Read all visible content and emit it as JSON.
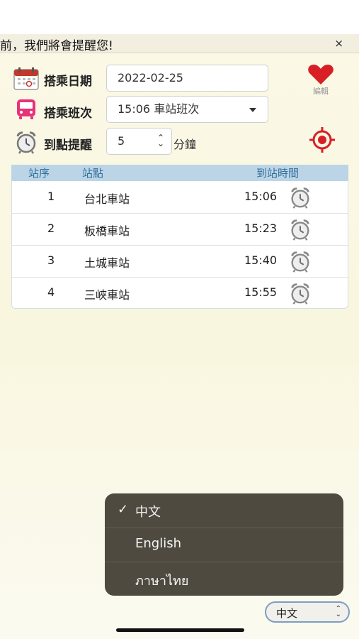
{
  "banner": {
    "text": "前，我們將會提醒您!",
    "close": "×"
  },
  "form": {
    "date_label": "搭乘日期",
    "date_value": "2022-02-25",
    "trip_label": "搭乘班次",
    "trip_value": "15:06 車站班次",
    "reminder_label": "到點提醒",
    "reminder_value": "5",
    "reminder_unit": "分鐘"
  },
  "actions": {
    "edit_label": "編輯"
  },
  "table": {
    "headers": [
      "站序",
      "站點",
      "到站時間"
    ],
    "rows": [
      {
        "seq": "1",
        "station": "台北車站",
        "time": "15:06"
      },
      {
        "seq": "2",
        "station": "板橋車站",
        "time": "15:23"
      },
      {
        "seq": "3",
        "station": "土城車站",
        "time": "15:40"
      },
      {
        "seq": "4",
        "station": "三峽車站",
        "time": "15:55"
      }
    ]
  },
  "language_menu": {
    "check": "✓",
    "options": [
      "中文",
      "English",
      "ภาษาไทย"
    ],
    "selected": "中文"
  },
  "language_select": {
    "value": "中文"
  },
  "colors": {
    "accent_red": "#d81f26",
    "header_bg": "#bcd5e6",
    "header_text": "#2f6f9e",
    "menu_bg": "#4e4a40"
  },
  "icons": [
    "calendar-icon",
    "bus-icon",
    "alarm-clock-icon",
    "heart-icon",
    "locate-target-icon"
  ]
}
